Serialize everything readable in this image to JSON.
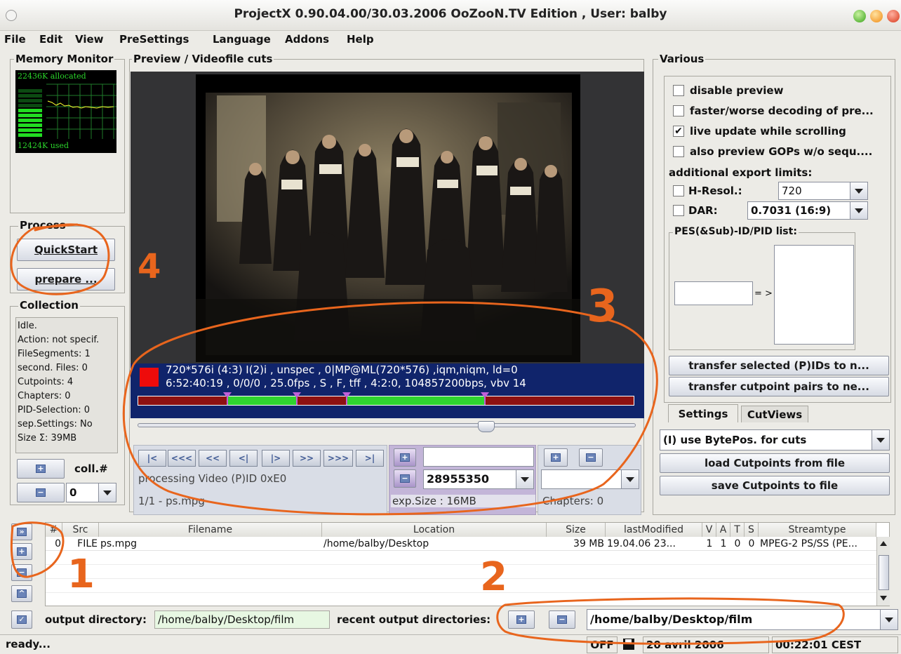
{
  "window": {
    "title": "ProjectX 0.90.04.00/30.03.2006 OoZooN.TV Edition , User: balby"
  },
  "menubar": {
    "items": [
      "File",
      "Edit",
      "View",
      "PreSettings",
      "Language",
      "Addons",
      "Help"
    ]
  },
  "memory_monitor": {
    "label": "Memory Monitor",
    "allocated": "22436K allocated",
    "used": "12424K used",
    "used_level": 0.55
  },
  "preview": {
    "label": "Preview / Videofile cuts",
    "info_line1": "720*576i (4:3) I(2)i , unspec , 0|MP@ML(720*576)  ,iqm,niqm, ld=0",
    "info_line2": "6:52:40:19 , 0/0/0 , 25.0fps , S , F, tff , 4:2:0, 104857200bps, vbv 14",
    "cutpoints_fraction": [
      0.18,
      0.32,
      0.42,
      0.7
    ],
    "slider_fraction": 0.7,
    "nav_buttons": [
      "|<",
      "<<<",
      "<<",
      "<|",
      "|>",
      ">>",
      ">>>",
      ">|"
    ],
    "status": "processing Video (P)ID 0xE0",
    "file_index": "1/1 - ps.mpg",
    "cut_value": "28955350",
    "exp_size": "exp.Size : 16MB",
    "chapters": "Chapters:  0"
  },
  "process": {
    "label": "Process",
    "quickstart": "QuickStart",
    "prepare": "prepare ..."
  },
  "collection": {
    "label": "Collection",
    "info": [
      "Idle.",
      "Action: not specif.",
      "FileSegments: 1",
      "second. Files: 0",
      "Cutpoints: 4",
      "Chapters: 0",
      "PID-Selection: 0",
      "sep.Settings: No",
      "Size Σ: 39MB"
    ],
    "coll_label": "coll.#",
    "coll_value": "0"
  },
  "various": {
    "label": "Various",
    "checks": [
      {
        "label": "disable preview",
        "checked": false
      },
      {
        "label": "faster/worse decoding of pre...",
        "checked": false
      },
      {
        "label": "live update while scrolling",
        "checked": true
      },
      {
        "label": "also preview GOPs w/o sequ....",
        "checked": false
      }
    ],
    "export_limits": "additional export limits:",
    "hresol_label": "H-Resol.:",
    "hresol_value": "720",
    "dar_label": "DAR:",
    "dar_value": "0.7031 (16:9)",
    "pid_list_label": "PES(&Sub)-ID/PID list:",
    "arrow": "= >",
    "transfer_pids": "transfer selected (P)IDs to n...",
    "transfer_cuts": "transfer cutpoint pairs to ne...",
    "tabs": [
      "Settings",
      "CutViews"
    ],
    "bytepos": "(I) use BytePos. for cuts",
    "load_cuts": "load Cutpoints from file",
    "save_cuts": "save Cutpoints to file"
  },
  "table": {
    "columns": [
      "#",
      "Src",
      "Filename",
      "Location",
      "Size",
      "lastModified",
      "V",
      "A",
      "T",
      "S",
      "Streamtype"
    ],
    "rows": [
      [
        "0",
        "FILE",
        "ps.mpg",
        "/home/balby/Desktop",
        "39 MB",
        "19.04.06  23...",
        "1",
        "1",
        "0",
        "0",
        "MPEG-2 PS/SS (PE..."
      ]
    ]
  },
  "output": {
    "label": "output directory:",
    "value": "/home/balby/Desktop/film",
    "recent_label": "recent output directories:",
    "recent_value": "/home/balby/Desktop/film"
  },
  "statusbar": {
    "left": "ready...",
    "off": "OFF",
    "date": "20 avril 2006",
    "time": "00:22:01 CEST"
  },
  "annotations": [
    "1",
    "2",
    "3",
    "4"
  ]
}
